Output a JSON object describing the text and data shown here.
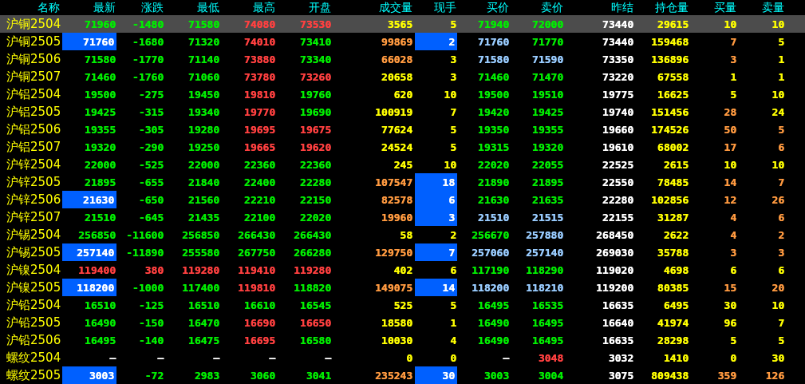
{
  "columns": [
    "名称",
    "最新",
    "涨跌",
    "最低",
    "最高",
    "开盘",
    "成交量",
    "现手",
    "买价",
    "卖价",
    "昨结",
    "持仓量",
    "买量",
    "卖量"
  ],
  "rows": [
    {
      "name": "沪铜2504",
      "selected": true,
      "cells": [
        {
          "value": "71960",
          "color": "#00ee00",
          "flash": false
        },
        {
          "value": "-1480",
          "color": "#00ee00",
          "flash": false
        },
        {
          "value": "71580",
          "color": "#00ee00",
          "flash": false
        },
        {
          "value": "74080",
          "color": "#ff4040",
          "flash": false
        },
        {
          "value": "73530",
          "color": "#ff4040",
          "flash": false
        },
        {
          "value": "3565",
          "color": "#ffff00",
          "flash": false
        },
        {
          "value": "5",
          "color": "#ffff00",
          "flash": false
        },
        {
          "value": "71940",
          "color": "#00ee00",
          "flash": false
        },
        {
          "value": "72000",
          "color": "#00ee00",
          "flash": false
        },
        {
          "value": "73440",
          "color": "#ffffff",
          "flash": false
        },
        {
          "value": "29615",
          "color": "#ffff00",
          "flash": false
        },
        {
          "value": "10",
          "color": "#ffff00",
          "flash": false
        },
        {
          "value": "10",
          "color": "#ffff00",
          "flash": false
        }
      ]
    },
    {
      "name": "沪铜2505",
      "selected": false,
      "cells": [
        {
          "value": "71760",
          "color": "#ffffff",
          "flash": true
        },
        {
          "value": "-1680",
          "color": "#00ee00",
          "flash": false
        },
        {
          "value": "71320",
          "color": "#00ee00",
          "flash": false
        },
        {
          "value": "74010",
          "color": "#ff4040",
          "flash": false
        },
        {
          "value": "73410",
          "color": "#00ee00",
          "flash": false
        },
        {
          "value": "99869",
          "color": "#ff9a40",
          "flash": false
        },
        {
          "value": "2",
          "color": "#ffffff",
          "flash": true
        },
        {
          "value": "71760",
          "color": "#99ccff",
          "flash": false
        },
        {
          "value": "71770",
          "color": "#00ee00",
          "flash": false
        },
        {
          "value": "73440",
          "color": "#ffffff",
          "flash": false
        },
        {
          "value": "159468",
          "color": "#ffff00",
          "flash": false
        },
        {
          "value": "7",
          "color": "#ff9a40",
          "flash": false
        },
        {
          "value": "5",
          "color": "#ffff00",
          "flash": false
        }
      ]
    },
    {
      "name": "沪铜2506",
      "selected": false,
      "cells": [
        {
          "value": "71580",
          "color": "#00ee00",
          "flash": false
        },
        {
          "value": "-1770",
          "color": "#00ee00",
          "flash": false
        },
        {
          "value": "71140",
          "color": "#00ee00",
          "flash": false
        },
        {
          "value": "73880",
          "color": "#ff4040",
          "flash": false
        },
        {
          "value": "73340",
          "color": "#00ee00",
          "flash": false
        },
        {
          "value": "66028",
          "color": "#ff9a40",
          "flash": false
        },
        {
          "value": "3",
          "color": "#ffff00",
          "flash": false
        },
        {
          "value": "71580",
          "color": "#99ccff",
          "flash": false
        },
        {
          "value": "71590",
          "color": "#99ccff",
          "flash": false
        },
        {
          "value": "73350",
          "color": "#ffffff",
          "flash": false
        },
        {
          "value": "136896",
          "color": "#ffff00",
          "flash": false
        },
        {
          "value": "3",
          "color": "#ff9a40",
          "flash": false
        },
        {
          "value": "1",
          "color": "#ffff00",
          "flash": false
        }
      ]
    },
    {
      "name": "沪铜2507",
      "selected": false,
      "cells": [
        {
          "value": "71460",
          "color": "#00ee00",
          "flash": false
        },
        {
          "value": "-1760",
          "color": "#00ee00",
          "flash": false
        },
        {
          "value": "71060",
          "color": "#00ee00",
          "flash": false
        },
        {
          "value": "73780",
          "color": "#ff4040",
          "flash": false
        },
        {
          "value": "73260",
          "color": "#ff4040",
          "flash": false
        },
        {
          "value": "20658",
          "color": "#ffff00",
          "flash": false
        },
        {
          "value": "3",
          "color": "#ffff00",
          "flash": false
        },
        {
          "value": "71460",
          "color": "#00ee00",
          "flash": false
        },
        {
          "value": "71470",
          "color": "#00ee00",
          "flash": false
        },
        {
          "value": "73220",
          "color": "#ffffff",
          "flash": false
        },
        {
          "value": "67558",
          "color": "#ffff00",
          "flash": false
        },
        {
          "value": "1",
          "color": "#ffff00",
          "flash": false
        },
        {
          "value": "1",
          "color": "#ffff00",
          "flash": false
        }
      ]
    },
    {
      "name": "沪铝2504",
      "selected": false,
      "cells": [
        {
          "value": "19500",
          "color": "#00ee00",
          "flash": false
        },
        {
          "value": "-275",
          "color": "#00ee00",
          "flash": false
        },
        {
          "value": "19450",
          "color": "#00ee00",
          "flash": false
        },
        {
          "value": "19810",
          "color": "#ff4040",
          "flash": false
        },
        {
          "value": "19760",
          "color": "#00ee00",
          "flash": false
        },
        {
          "value": "620",
          "color": "#ffff00",
          "flash": false
        },
        {
          "value": "10",
          "color": "#ffff00",
          "flash": false
        },
        {
          "value": "19500",
          "color": "#00ee00",
          "flash": false
        },
        {
          "value": "19510",
          "color": "#00ee00",
          "flash": false
        },
        {
          "value": "19775",
          "color": "#ffffff",
          "flash": false
        },
        {
          "value": "16625",
          "color": "#ffff00",
          "flash": false
        },
        {
          "value": "5",
          "color": "#ffff00",
          "flash": false
        },
        {
          "value": "10",
          "color": "#ffff00",
          "flash": false
        }
      ]
    },
    {
      "name": "沪铝2505",
      "selected": false,
      "cells": [
        {
          "value": "19425",
          "color": "#00ee00",
          "flash": false
        },
        {
          "value": "-315",
          "color": "#00ee00",
          "flash": false
        },
        {
          "value": "19340",
          "color": "#00ee00",
          "flash": false
        },
        {
          "value": "19770",
          "color": "#ff4040",
          "flash": false
        },
        {
          "value": "19690",
          "color": "#00ee00",
          "flash": false
        },
        {
          "value": "100919",
          "color": "#ffff00",
          "flash": false
        },
        {
          "value": "7",
          "color": "#ffff00",
          "flash": false
        },
        {
          "value": "19420",
          "color": "#00ee00",
          "flash": false
        },
        {
          "value": "19425",
          "color": "#00ee00",
          "flash": false
        },
        {
          "value": "19740",
          "color": "#ffffff",
          "flash": false
        },
        {
          "value": "151456",
          "color": "#ffff00",
          "flash": false
        },
        {
          "value": "28",
          "color": "#ff9a40",
          "flash": false
        },
        {
          "value": "24",
          "color": "#ffff00",
          "flash": false
        }
      ]
    },
    {
      "name": "沪铝2506",
      "selected": false,
      "cells": [
        {
          "value": "19355",
          "color": "#00ee00",
          "flash": false
        },
        {
          "value": "-305",
          "color": "#00ee00",
          "flash": false
        },
        {
          "value": "19280",
          "color": "#00ee00",
          "flash": false
        },
        {
          "value": "19695",
          "color": "#ff4040",
          "flash": false
        },
        {
          "value": "19675",
          "color": "#ff4040",
          "flash": false
        },
        {
          "value": "77624",
          "color": "#ffff00",
          "flash": false
        },
        {
          "value": "5",
          "color": "#ffff00",
          "flash": false
        },
        {
          "value": "19350",
          "color": "#00ee00",
          "flash": false
        },
        {
          "value": "19355",
          "color": "#00ee00",
          "flash": false
        },
        {
          "value": "19660",
          "color": "#ffffff",
          "flash": false
        },
        {
          "value": "174526",
          "color": "#ffff00",
          "flash": false
        },
        {
          "value": "50",
          "color": "#ff9a40",
          "flash": false
        },
        {
          "value": "5",
          "color": "#ff9a40",
          "flash": false
        }
      ]
    },
    {
      "name": "沪铝2507",
      "selected": false,
      "cells": [
        {
          "value": "19320",
          "color": "#00ee00",
          "flash": false
        },
        {
          "value": "-290",
          "color": "#00ee00",
          "flash": false
        },
        {
          "value": "19250",
          "color": "#00ee00",
          "flash": false
        },
        {
          "value": "19665",
          "color": "#ff4040",
          "flash": false
        },
        {
          "value": "19620",
          "color": "#ff4040",
          "flash": false
        },
        {
          "value": "24524",
          "color": "#ffff00",
          "flash": false
        },
        {
          "value": "5",
          "color": "#ffff00",
          "flash": false
        },
        {
          "value": "19315",
          "color": "#00ee00",
          "flash": false
        },
        {
          "value": "19320",
          "color": "#00ee00",
          "flash": false
        },
        {
          "value": "19610",
          "color": "#ffffff",
          "flash": false
        },
        {
          "value": "68002",
          "color": "#ffff00",
          "flash": false
        },
        {
          "value": "17",
          "color": "#ff9a40",
          "flash": false
        },
        {
          "value": "6",
          "color": "#ff9a40",
          "flash": false
        }
      ]
    },
    {
      "name": "沪锌2504",
      "selected": false,
      "cells": [
        {
          "value": "22000",
          "color": "#00ee00",
          "flash": false
        },
        {
          "value": "-525",
          "color": "#00ee00",
          "flash": false
        },
        {
          "value": "22000",
          "color": "#00ee00",
          "flash": false
        },
        {
          "value": "22360",
          "color": "#00ee00",
          "flash": false
        },
        {
          "value": "22360",
          "color": "#00ee00",
          "flash": false
        },
        {
          "value": "245",
          "color": "#ffff00",
          "flash": false
        },
        {
          "value": "10",
          "color": "#ffff00",
          "flash": false
        },
        {
          "value": "22020",
          "color": "#00ee00",
          "flash": false
        },
        {
          "value": "22055",
          "color": "#00ee00",
          "flash": false
        },
        {
          "value": "22525",
          "color": "#ffffff",
          "flash": false
        },
        {
          "value": "2615",
          "color": "#ffff00",
          "flash": false
        },
        {
          "value": "10",
          "color": "#ffff00",
          "flash": false
        },
        {
          "value": "10",
          "color": "#ffff00",
          "flash": false
        }
      ]
    },
    {
      "name": "沪锌2505",
      "selected": false,
      "cells": [
        {
          "value": "21895",
          "color": "#00ee00",
          "flash": false
        },
        {
          "value": "-655",
          "color": "#00ee00",
          "flash": false
        },
        {
          "value": "21840",
          "color": "#00ee00",
          "flash": false
        },
        {
          "value": "22400",
          "color": "#00ee00",
          "flash": false
        },
        {
          "value": "22280",
          "color": "#00ee00",
          "flash": false
        },
        {
          "value": "107547",
          "color": "#ff9a40",
          "flash": false
        },
        {
          "value": "18",
          "color": "#ffffff",
          "flash": true
        },
        {
          "value": "21890",
          "color": "#00ee00",
          "flash": false
        },
        {
          "value": "21895",
          "color": "#00ee00",
          "flash": false
        },
        {
          "value": "22550",
          "color": "#ffffff",
          "flash": false
        },
        {
          "value": "78485",
          "color": "#ffff00",
          "flash": false
        },
        {
          "value": "14",
          "color": "#ff9a40",
          "flash": false
        },
        {
          "value": "7",
          "color": "#ff9a40",
          "flash": false
        }
      ]
    },
    {
      "name": "沪锌2506",
      "selected": false,
      "cells": [
        {
          "value": "21630",
          "color": "#ffffff",
          "flash": true
        },
        {
          "value": "-650",
          "color": "#00ee00",
          "flash": false
        },
        {
          "value": "21560",
          "color": "#00ee00",
          "flash": false
        },
        {
          "value": "22210",
          "color": "#00ee00",
          "flash": false
        },
        {
          "value": "22150",
          "color": "#00ee00",
          "flash": false
        },
        {
          "value": "82578",
          "color": "#ff9a40",
          "flash": false
        },
        {
          "value": "6",
          "color": "#ffffff",
          "flash": true
        },
        {
          "value": "21630",
          "color": "#00ee00",
          "flash": false
        },
        {
          "value": "21635",
          "color": "#00ee00",
          "flash": false
        },
        {
          "value": "22280",
          "color": "#ffffff",
          "flash": false
        },
        {
          "value": "102856",
          "color": "#ffff00",
          "flash": false
        },
        {
          "value": "12",
          "color": "#ff9a40",
          "flash": false
        },
        {
          "value": "26",
          "color": "#ff9a40",
          "flash": false
        }
      ]
    },
    {
      "name": "沪锌2507",
      "selected": false,
      "cells": [
        {
          "value": "21510",
          "color": "#00ee00",
          "flash": false
        },
        {
          "value": "-645",
          "color": "#00ee00",
          "flash": false
        },
        {
          "value": "21435",
          "color": "#00ee00",
          "flash": false
        },
        {
          "value": "22100",
          "color": "#00ee00",
          "flash": false
        },
        {
          "value": "22020",
          "color": "#00ee00",
          "flash": false
        },
        {
          "value": "19960",
          "color": "#ff9a40",
          "flash": false
        },
        {
          "value": "3",
          "color": "#ffffff",
          "flash": true
        },
        {
          "value": "21510",
          "color": "#99ccff",
          "flash": false
        },
        {
          "value": "21515",
          "color": "#99ccff",
          "flash": false
        },
        {
          "value": "22155",
          "color": "#ffffff",
          "flash": false
        },
        {
          "value": "31287",
          "color": "#ffff00",
          "flash": false
        },
        {
          "value": "4",
          "color": "#ff9a40",
          "flash": false
        },
        {
          "value": "6",
          "color": "#ff9a40",
          "flash": false
        }
      ]
    },
    {
      "name": "沪锡2504",
      "selected": false,
      "cells": [
        {
          "value": "256850",
          "color": "#00ee00",
          "flash": false
        },
        {
          "value": "-11600",
          "color": "#00ee00",
          "flash": false
        },
        {
          "value": "256850",
          "color": "#00ee00",
          "flash": false
        },
        {
          "value": "266430",
          "color": "#00ee00",
          "flash": false
        },
        {
          "value": "266430",
          "color": "#00ee00",
          "flash": false
        },
        {
          "value": "58",
          "color": "#ffff00",
          "flash": false
        },
        {
          "value": "2",
          "color": "#ffff00",
          "flash": false
        },
        {
          "value": "256670",
          "color": "#00ee00",
          "flash": false
        },
        {
          "value": "257880",
          "color": "#99ccff",
          "flash": false
        },
        {
          "value": "268450",
          "color": "#ffffff",
          "flash": false
        },
        {
          "value": "2622",
          "color": "#ffff00",
          "flash": false
        },
        {
          "value": "4",
          "color": "#ff9a40",
          "flash": false
        },
        {
          "value": "2",
          "color": "#ff9a40",
          "flash": false
        }
      ]
    },
    {
      "name": "沪锡2505",
      "selected": false,
      "cells": [
        {
          "value": "257140",
          "color": "#ffffff",
          "flash": true
        },
        {
          "value": "-11890",
          "color": "#00ee00",
          "flash": false
        },
        {
          "value": "255580",
          "color": "#00ee00",
          "flash": false
        },
        {
          "value": "267750",
          "color": "#00ee00",
          "flash": false
        },
        {
          "value": "266280",
          "color": "#00ee00",
          "flash": false
        },
        {
          "value": "129750",
          "color": "#ff9a40",
          "flash": false
        },
        {
          "value": "7",
          "color": "#ffffff",
          "flash": true
        },
        {
          "value": "257060",
          "color": "#99ccff",
          "flash": false
        },
        {
          "value": "257140",
          "color": "#99ccff",
          "flash": false
        },
        {
          "value": "269030",
          "color": "#ffffff",
          "flash": false
        },
        {
          "value": "35788",
          "color": "#ffff00",
          "flash": false
        },
        {
          "value": "3",
          "color": "#ff9a40",
          "flash": false
        },
        {
          "value": "3",
          "color": "#ff9a40",
          "flash": false
        }
      ]
    },
    {
      "name": "沪镍2504",
      "selected": false,
      "cells": [
        {
          "value": "119400",
          "color": "#ff4040",
          "flash": false
        },
        {
          "value": "380",
          "color": "#ff4040",
          "flash": false
        },
        {
          "value": "119280",
          "color": "#ff4040",
          "flash": false
        },
        {
          "value": "119410",
          "color": "#ff4040",
          "flash": false
        },
        {
          "value": "119280",
          "color": "#ff4040",
          "flash": false
        },
        {
          "value": "402",
          "color": "#ffff00",
          "flash": false
        },
        {
          "value": "6",
          "color": "#ffff00",
          "flash": false
        },
        {
          "value": "117190",
          "color": "#00ee00",
          "flash": false
        },
        {
          "value": "118290",
          "color": "#00ee00",
          "flash": false
        },
        {
          "value": "119020",
          "color": "#ffffff",
          "flash": false
        },
        {
          "value": "4698",
          "color": "#ffff00",
          "flash": false
        },
        {
          "value": "6",
          "color": "#ffff00",
          "flash": false
        },
        {
          "value": "6",
          "color": "#ffff00",
          "flash": false
        }
      ]
    },
    {
      "name": "沪镍2505",
      "selected": false,
      "cells": [
        {
          "value": "118200",
          "color": "#ffffff",
          "flash": true
        },
        {
          "value": "-1000",
          "color": "#00ee00",
          "flash": false
        },
        {
          "value": "117400",
          "color": "#00ee00",
          "flash": false
        },
        {
          "value": "119810",
          "color": "#ff4040",
          "flash": false
        },
        {
          "value": "118820",
          "color": "#00ee00",
          "flash": false
        },
        {
          "value": "149075",
          "color": "#ff9a40",
          "flash": false
        },
        {
          "value": "14",
          "color": "#ffffff",
          "flash": true
        },
        {
          "value": "118200",
          "color": "#99ccff",
          "flash": false
        },
        {
          "value": "118210",
          "color": "#99ccff",
          "flash": false
        },
        {
          "value": "119200",
          "color": "#ffffff",
          "flash": false
        },
        {
          "value": "80385",
          "color": "#ffff00",
          "flash": false
        },
        {
          "value": "15",
          "color": "#ff9a40",
          "flash": false
        },
        {
          "value": "20",
          "color": "#ff9a40",
          "flash": false
        }
      ]
    },
    {
      "name": "沪铅2504",
      "selected": false,
      "cells": [
        {
          "value": "16510",
          "color": "#00ee00",
          "flash": false
        },
        {
          "value": "-125",
          "color": "#00ee00",
          "flash": false
        },
        {
          "value": "16510",
          "color": "#00ee00",
          "flash": false
        },
        {
          "value": "16610",
          "color": "#00ee00",
          "flash": false
        },
        {
          "value": "16545",
          "color": "#00ee00",
          "flash": false
        },
        {
          "value": "525",
          "color": "#ffff00",
          "flash": false
        },
        {
          "value": "5",
          "color": "#ffff00",
          "flash": false
        },
        {
          "value": "16495",
          "color": "#00ee00",
          "flash": false
        },
        {
          "value": "16535",
          "color": "#00ee00",
          "flash": false
        },
        {
          "value": "16635",
          "color": "#ffffff",
          "flash": false
        },
        {
          "value": "6495",
          "color": "#ffff00",
          "flash": false
        },
        {
          "value": "30",
          "color": "#ffff00",
          "flash": false
        },
        {
          "value": "10",
          "color": "#ffff00",
          "flash": false
        }
      ]
    },
    {
      "name": "沪铅2505",
      "selected": false,
      "cells": [
        {
          "value": "16490",
          "color": "#00ee00",
          "flash": false
        },
        {
          "value": "-150",
          "color": "#00ee00",
          "flash": false
        },
        {
          "value": "16470",
          "color": "#00ee00",
          "flash": false
        },
        {
          "value": "16690",
          "color": "#ff4040",
          "flash": false
        },
        {
          "value": "16650",
          "color": "#ff4040",
          "flash": false
        },
        {
          "value": "18580",
          "color": "#ffff00",
          "flash": false
        },
        {
          "value": "1",
          "color": "#ffff00",
          "flash": false
        },
        {
          "value": "16490",
          "color": "#00ee00",
          "flash": false
        },
        {
          "value": "16495",
          "color": "#00ee00",
          "flash": false
        },
        {
          "value": "16640",
          "color": "#ffffff",
          "flash": false
        },
        {
          "value": "41974",
          "color": "#ffff00",
          "flash": false
        },
        {
          "value": "96",
          "color": "#ffff00",
          "flash": false
        },
        {
          "value": "7",
          "color": "#ffff00",
          "flash": false
        }
      ]
    },
    {
      "name": "沪铅2506",
      "selected": false,
      "cells": [
        {
          "value": "16495",
          "color": "#00ee00",
          "flash": false
        },
        {
          "value": "-140",
          "color": "#00ee00",
          "flash": false
        },
        {
          "value": "16475",
          "color": "#00ee00",
          "flash": false
        },
        {
          "value": "16695",
          "color": "#ff4040",
          "flash": false
        },
        {
          "value": "16580",
          "color": "#00ee00",
          "flash": false
        },
        {
          "value": "10030",
          "color": "#ffff00",
          "flash": false
        },
        {
          "value": "4",
          "color": "#ffff00",
          "flash": false
        },
        {
          "value": "16490",
          "color": "#00ee00",
          "flash": false
        },
        {
          "value": "16495",
          "color": "#00ee00",
          "flash": false
        },
        {
          "value": "16635",
          "color": "#ffffff",
          "flash": false
        },
        {
          "value": "28298",
          "color": "#ffff00",
          "flash": false
        },
        {
          "value": "5",
          "color": "#ffff00",
          "flash": false
        },
        {
          "value": "5",
          "color": "#ffff00",
          "flash": false
        }
      ]
    },
    {
      "name": "螺纹2504",
      "selected": false,
      "cells": [
        {
          "value": "—",
          "color": "#ffffff",
          "flash": false
        },
        {
          "value": "—",
          "color": "#ffffff",
          "flash": false
        },
        {
          "value": "—",
          "color": "#ffffff",
          "flash": false
        },
        {
          "value": "—",
          "color": "#ffffff",
          "flash": false
        },
        {
          "value": "—",
          "color": "#ffffff",
          "flash": false
        },
        {
          "value": "0",
          "color": "#ffff00",
          "flash": false
        },
        {
          "value": "0",
          "color": "#ffff00",
          "flash": false
        },
        {
          "value": "—",
          "color": "#ffffff",
          "flash": false
        },
        {
          "value": "3048",
          "color": "#ff4040",
          "flash": false
        },
        {
          "value": "3032",
          "color": "#ffffff",
          "flash": false
        },
        {
          "value": "1410",
          "color": "#ffff00",
          "flash": false
        },
        {
          "value": "0",
          "color": "#ffff00",
          "flash": false
        },
        {
          "value": "30",
          "color": "#ffff00",
          "flash": false
        }
      ]
    },
    {
      "name": "螺纹2505",
      "selected": false,
      "cells": [
        {
          "value": "3003",
          "color": "#ffffff",
          "flash": true
        },
        {
          "value": "-72",
          "color": "#00ee00",
          "flash": false
        },
        {
          "value": "2983",
          "color": "#00ee00",
          "flash": false
        },
        {
          "value": "3060",
          "color": "#00ee00",
          "flash": false
        },
        {
          "value": "3041",
          "color": "#00ee00",
          "flash": false
        },
        {
          "value": "235243",
          "color": "#ff9a40",
          "flash": false
        },
        {
          "value": "30",
          "color": "#ffffff",
          "flash": true
        },
        {
          "value": "3003",
          "color": "#00ee00",
          "flash": false
        },
        {
          "value": "3004",
          "color": "#00ee00",
          "flash": false
        },
        {
          "value": "3075",
          "color": "#ffffff",
          "flash": false
        },
        {
          "value": "809438",
          "color": "#ffff00",
          "flash": false
        },
        {
          "value": "359",
          "color": "#ff9a40",
          "flash": false
        },
        {
          "value": "126",
          "color": "#ff9a40",
          "flash": false
        }
      ]
    }
  ]
}
